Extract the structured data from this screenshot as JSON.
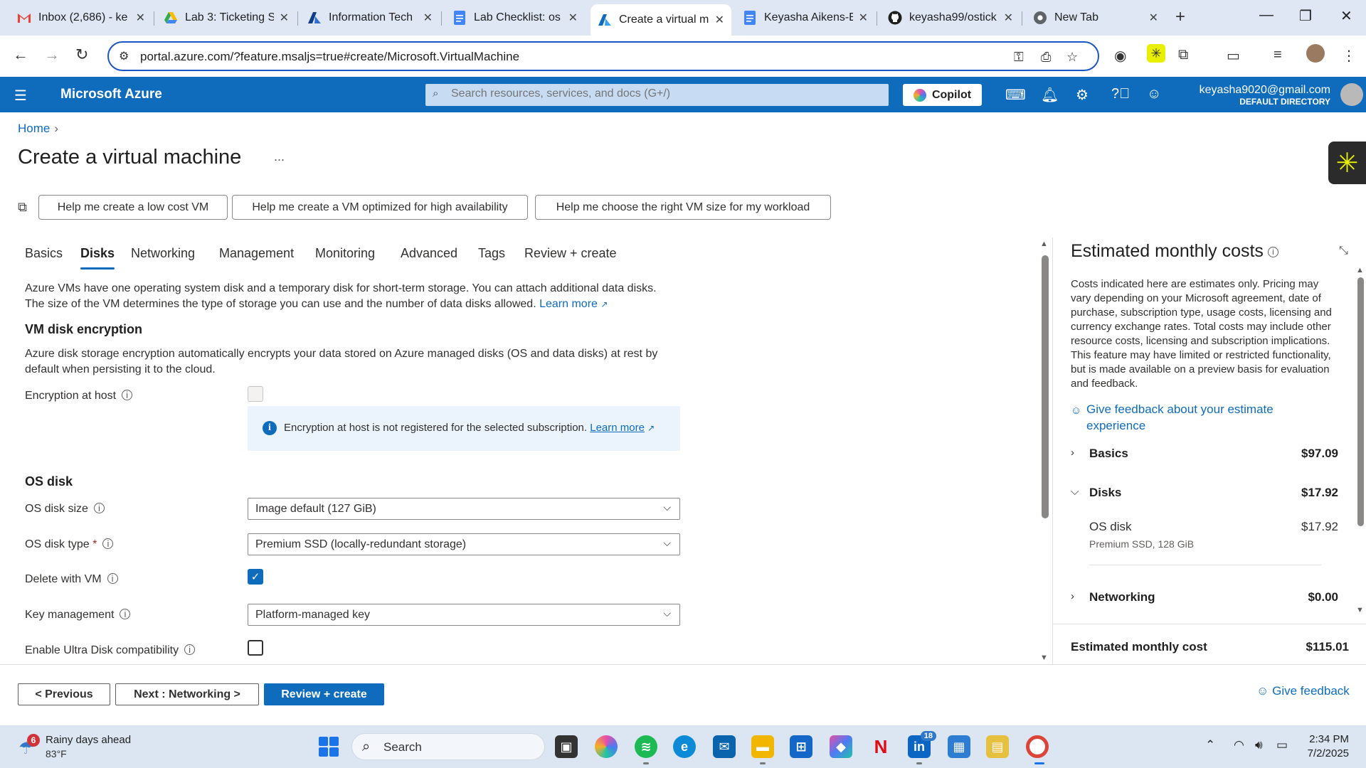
{
  "browser": {
    "tabs": [
      {
        "title": "Inbox (2,686) - ke",
        "icon": "gmail-icon",
        "color": "#ea4335"
      },
      {
        "title": "Lab 3: Ticketing S",
        "icon": "drive-icon",
        "color": "#34a853"
      },
      {
        "title": "Information Tech",
        "icon": "azure-icon",
        "color": "#0f3d8a"
      },
      {
        "title": "Lab Checklist: os",
        "icon": "docs-icon",
        "color": "#4285f4"
      },
      {
        "title": "Create a virtual m",
        "icon": "azure-icon",
        "color": "#0f6cbd"
      },
      {
        "title": "Keyasha Aikens-E",
        "icon": "docs-icon",
        "color": "#4285f4"
      },
      {
        "title": "keyasha99/ostick",
        "icon": "github-icon",
        "color": "#1f1f1f"
      },
      {
        "title": "New Tab",
        "icon": "chrome-icon",
        "color": "#5f6368"
      }
    ],
    "active_tab": 4,
    "url": "portal.azure.com/?feature.msaljs=true#create/Microsoft.VirtualMachine"
  },
  "azure": {
    "brand": "Microsoft Azure",
    "search_placeholder": "Search resources, services, and docs (G+/)",
    "copilot_label": "Copilot",
    "account_email": "keyasha9020@gmail.com",
    "account_directory": "DEFAULT DIRECTORY"
  },
  "page": {
    "breadcrumb_home": "Home",
    "title": "Create a virtual machine",
    "more": "...",
    "help_buttons": [
      "Help me create a low cost VM",
      "Help me create a VM optimized for high availability",
      "Help me choose the right VM size for my workload"
    ],
    "tabs": [
      "Basics",
      "Disks",
      "Networking",
      "Management",
      "Monitoring",
      "Advanced",
      "Tags",
      "Review + create"
    ],
    "active_tab": "Disks",
    "intro_line1": "Azure VMs have one operating system disk and a temporary disk for short-term storage. You can attach additional data disks.",
    "intro_line2": "The size of the VM determines the type of storage you can use and the number of data disks allowed.",
    "learn_more": "Learn more",
    "encryption_title": "VM disk encryption",
    "encryption_desc": "Azure disk storage encryption automatically encrypts your data stored on Azure managed disks (OS and data disks) at rest by default when persisting it to the cloud.",
    "encryption_at_host_label": "Encryption at host",
    "encryption_info": "Encryption at host is not registered for the selected subscription.",
    "os_disk_title": "OS disk",
    "os_disk_size_label": "OS disk size",
    "os_disk_size_value": "Image default (127 GiB)",
    "os_disk_type_label": "OS disk type",
    "os_disk_type_value": "Premium SSD (locally-redundant storage)",
    "delete_with_vm_label": "Delete with VM",
    "key_management_label": "Key management",
    "key_management_value": "Platform-managed key",
    "ultra_disk_label": "Enable Ultra Disk compatibility"
  },
  "footer": {
    "previous": "< Previous",
    "next": "Next : Networking >",
    "review": "Review + create",
    "feedback": "Give feedback"
  },
  "cost": {
    "title": "Estimated monthly costs",
    "description": "Costs indicated here are estimates only. Pricing may vary depending on your Microsoft agreement, date of purchase, subscription type, usage costs, licensing and currency exchange rates. Total costs may include other resource costs, licensing and subscription implications. This feature may have limited or restricted functionality, but is made available on a preview basis for evaluation and feedback.",
    "feedback_link": "Give feedback about your estimate experience",
    "basics_label": "Basics",
    "basics_amount": "$97.09",
    "disks_label": "Disks",
    "disks_amount": "$17.92",
    "os_disk_label": "OS disk",
    "os_disk_amount": "$17.92",
    "os_disk_detail": "Premium SSD, 128 GiB",
    "networking_label": "Networking",
    "networking_amount": "$0.00",
    "total_label": "Estimated monthly cost",
    "total_amount": "$115.01"
  },
  "taskbar": {
    "weather_title": "Rainy days ahead",
    "weather_temp": "83°F",
    "weather_badge": "6",
    "search_label": "Search",
    "linkedin_badge": "18",
    "time": "2:34 PM",
    "date": "7/2/2025"
  }
}
